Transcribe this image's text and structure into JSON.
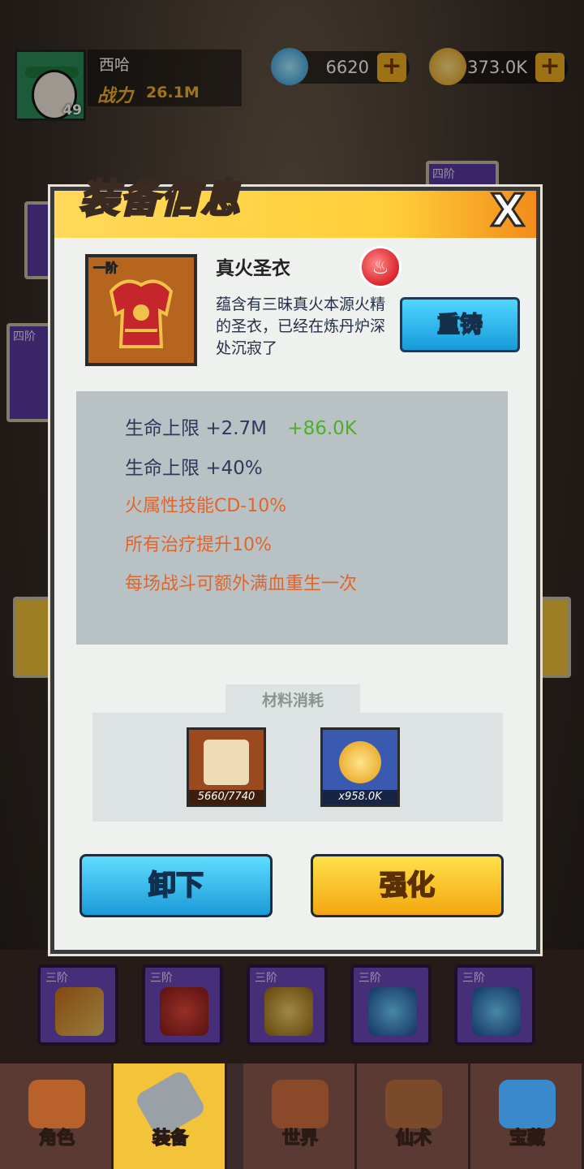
{
  "player": {
    "name": "西哈",
    "level": "49",
    "power_label": "战力",
    "power_value": "26.1M"
  },
  "resources": [
    {
      "icon": "diamond-icon",
      "value": "6620",
      "plus": "+"
    },
    {
      "icon": "gold-coin-icon",
      "value": "373.0K",
      "plus": "+"
    }
  ],
  "modal": {
    "title": "装备信息",
    "close": "X",
    "item": {
      "tier": "一阶",
      "name": "真火圣衣",
      "element_icon": "fire-icon",
      "description": "蕴含有三昧真火本源火精的圣衣，已经在炼丹炉深处沉寂了",
      "reforge_label": "重铸"
    },
    "stats": {
      "line1_label": "生命上限",
      "line1_value": "+2.7M",
      "line1_bonus": "+86.0K",
      "line2_label": "生命上限",
      "line2_value": "+40%",
      "special1": "火属性技能CD-10%",
      "special2": "所有治疗提升10%",
      "special3": "每场战斗可额外满血重生一次"
    },
    "materials": {
      "title": "材料消耗",
      "items": [
        {
          "icon": "armor-scroll-icon",
          "count": "5660/7740"
        },
        {
          "icon": "gold-coin-icon",
          "count": "x958.0K"
        }
      ]
    },
    "unequip_label": "卸下",
    "enhance_label": "强化"
  },
  "equipment_row": [
    {
      "tier": "三阶",
      "icon": "staff-icon"
    },
    {
      "tier": "三阶",
      "icon": "red-helmet-icon"
    },
    {
      "tier": "三阶",
      "icon": "gold-helmet-icon"
    },
    {
      "tier": "三阶",
      "icon": "blue-crown-icon"
    },
    {
      "tier": "三阶",
      "icon": "blue-crown-icon"
    }
  ],
  "background_slots": [
    {
      "tier": "四阶"
    },
    {
      "tier": "四阶"
    }
  ],
  "nav": [
    {
      "label": "角色",
      "icon": "monkey-icon"
    },
    {
      "label": "装备",
      "icon": "sword-icon"
    },
    {
      "label": "世界",
      "icon": "pagoda-icon"
    },
    {
      "label": "仙术",
      "icon": "cauldron-icon"
    },
    {
      "label": "宝藏",
      "icon": "chest-icon"
    }
  ],
  "colors": {
    "accent_yellow": "#f4b322",
    "stat_green": "#4fae2a",
    "special_orange": "#e2642b"
  }
}
